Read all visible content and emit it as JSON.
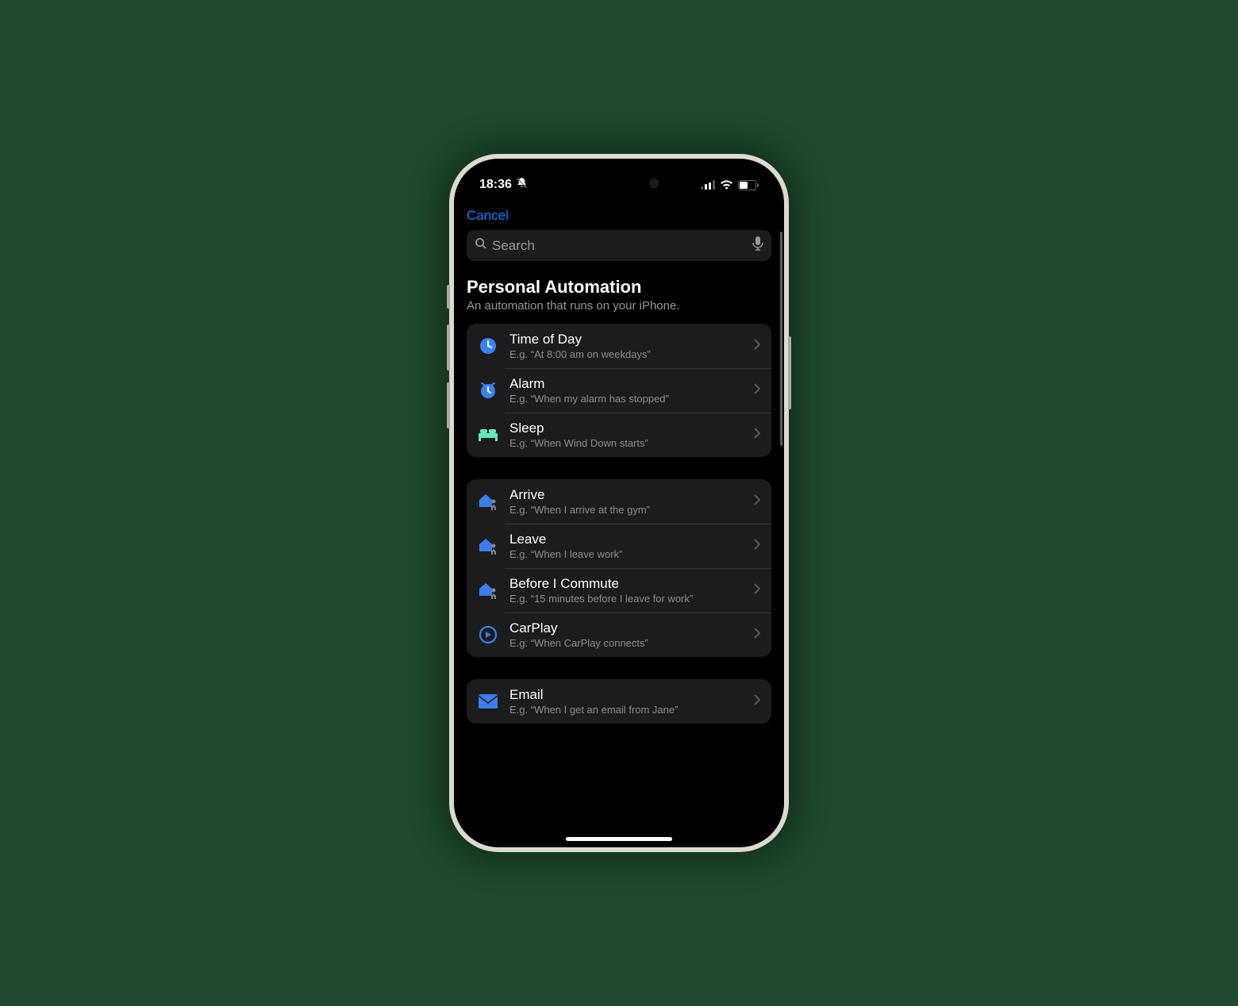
{
  "status": {
    "time": "18:36",
    "dndEnabled": true
  },
  "nav": {
    "cancel": "Cancel"
  },
  "search": {
    "placeholder": "Search"
  },
  "section": {
    "title": "Personal Automation",
    "subtitle": "An automation that runs on your iPhone."
  },
  "groups": [
    {
      "items": [
        {
          "icon": "clock-icon",
          "iconColor": "#3b82f6",
          "title": "Time of Day",
          "subtitle": "E.g. “At 8:00 am on weekdays”"
        },
        {
          "icon": "alarm-icon",
          "iconColor": "#3b82f6",
          "title": "Alarm",
          "subtitle": "E.g. “When my alarm has stopped”"
        },
        {
          "icon": "bed-icon",
          "iconColor": "#63e6be",
          "title": "Sleep",
          "subtitle": "E.g. “When Wind Down starts”"
        }
      ]
    },
    {
      "items": [
        {
          "icon": "home-person-icon",
          "iconColor": "#3b82f6",
          "title": "Arrive",
          "subtitle": "E.g. “When I arrive at the gym”"
        },
        {
          "icon": "home-person-icon",
          "iconColor": "#3b82f6",
          "title": "Leave",
          "subtitle": "E.g. “When I leave work”"
        },
        {
          "icon": "home-person-icon",
          "iconColor": "#3b82f6",
          "title": "Before I Commute",
          "subtitle": "E.g. “15 minutes before I leave for work”"
        },
        {
          "icon": "carplay-icon",
          "iconColor": "#3b82f6",
          "title": "CarPlay",
          "subtitle": "E.g. “When CarPlay connects”"
        }
      ]
    },
    {
      "items": [
        {
          "icon": "mail-icon",
          "iconColor": "#3b82f6",
          "title": "Email",
          "subtitle": "E.g. “When I get an email from Jane”"
        }
      ]
    }
  ]
}
